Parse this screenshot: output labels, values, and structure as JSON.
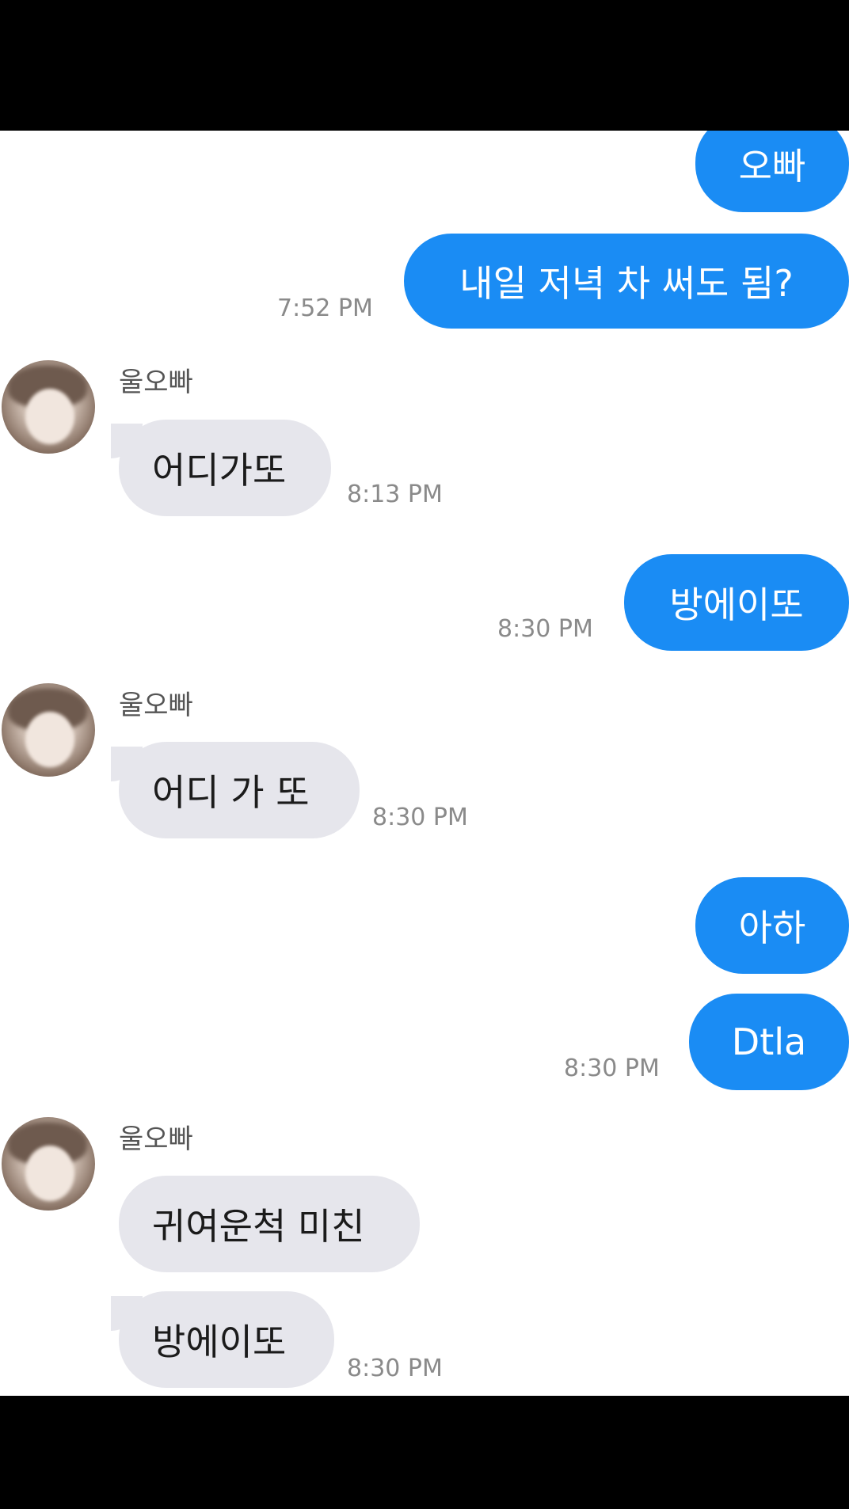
{
  "messages": [
    {
      "text": "오빠"
    },
    {
      "text": "내일 저녁 차 써도 됨?",
      "time": "7:52 PM"
    },
    {
      "sender": "울오빠",
      "text": "어디가또",
      "time": "8:13 PM"
    },
    {
      "text": "방에이또",
      "time": "8:30 PM"
    },
    {
      "sender": "울오빠",
      "text": "어디 가 또",
      "time": "8:30 PM"
    },
    {
      "text": "아하"
    },
    {
      "text": "Dtla",
      "time": "8:30 PM"
    },
    {
      "sender": "울오빠",
      "text": "귀여운척 미친"
    },
    {
      "text": "방에이또",
      "time": "8:30 PM"
    }
  ],
  "colors": {
    "outgoing_bubble": "#1a8cf4",
    "incoming_bubble": "#e6e6ec",
    "timestamp": "#8a8a8a",
    "letterbox": "#000000"
  },
  "icons": {
    "avatar": "profile-photo"
  }
}
